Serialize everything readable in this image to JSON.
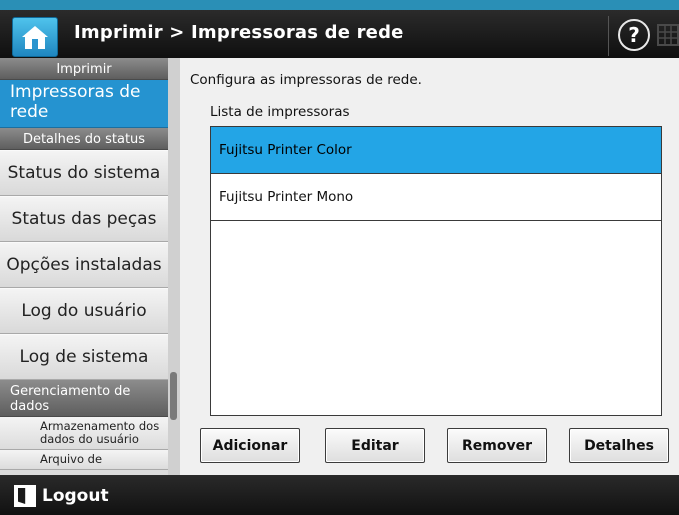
{
  "header": {
    "title": "Imprimir > Impressoras de rede",
    "help_label": "?"
  },
  "sidebar": {
    "section1_title": "Imprimir",
    "active_item": "Impressoras de rede",
    "section2_title": "Detalhes do status",
    "items": [
      {
        "label": "Status do sistema"
      },
      {
        "label": "Status das peças"
      },
      {
        "label": "Opções instaladas"
      },
      {
        "label": "Log do usuário"
      },
      {
        "label": "Log de sistema"
      }
    ],
    "section3_title": "Gerenciamento de dados",
    "sub_items": [
      {
        "label": "Armazenamento dos dados do usuário"
      },
      {
        "label": "Arquivo de"
      }
    ]
  },
  "main": {
    "intro": "Configura as impressoras de rede.",
    "list_label": "Lista de impressoras",
    "printers": [
      {
        "name": "Fujitsu Printer Color",
        "selected": true
      },
      {
        "name": "Fujitsu Printer Mono",
        "selected": false
      }
    ],
    "buttons": {
      "add": "Adicionar",
      "edit": "Editar",
      "remove": "Remover",
      "details": "Detalhes"
    }
  },
  "footer": {
    "logout_label": "Logout"
  },
  "colors": {
    "accent": "#2593d0",
    "selection": "#23a5e6",
    "header_bg": "#111111"
  }
}
